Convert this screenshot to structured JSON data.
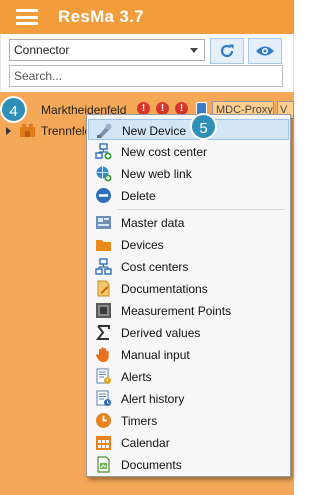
{
  "app": {
    "title": "ResMa 3.7"
  },
  "toolbar": {
    "selector_value": "Connector",
    "search_placeholder": "Search..."
  },
  "tree": {
    "rows": [
      {
        "label": "Marktheidenfeld",
        "alerts": [
          "!",
          "!",
          "!"
        ],
        "tag": "MDC-Proxy",
        "tag2": "V"
      },
      {
        "label": "Trennfeld"
      }
    ]
  },
  "annotations": {
    "step4": "4",
    "step5": "5"
  },
  "context_menu": {
    "items": [
      {
        "label": "New Device",
        "icon": "new-device-icon",
        "highlighted": true
      },
      {
        "label": "New cost center",
        "icon": "new-cost-center-icon"
      },
      {
        "label": "New web link",
        "icon": "new-web-link-icon"
      },
      {
        "label": "Delete",
        "icon": "delete-icon"
      },
      {
        "label": "Master data",
        "icon": "master-data-icon"
      },
      {
        "label": "Devices",
        "icon": "devices-folder-icon"
      },
      {
        "label": "Cost centers",
        "icon": "cost-centers-icon"
      },
      {
        "label": "Documentations",
        "icon": "documentations-icon"
      },
      {
        "label": "Measurement Points",
        "icon": "measurement-points-icon"
      },
      {
        "label": "Derived values",
        "icon": "sigma-icon"
      },
      {
        "label": "Manual input",
        "icon": "hand-icon"
      },
      {
        "label": "Alerts",
        "icon": "alerts-icon"
      },
      {
        "label": "Alert history",
        "icon": "alert-history-icon"
      },
      {
        "label": "Timers",
        "icon": "clock-icon"
      },
      {
        "label": "Calendar",
        "icon": "calendar-icon"
      },
      {
        "label": "Documents",
        "icon": "documents-icon"
      }
    ]
  },
  "colors": {
    "titlebar": "#f39c3c",
    "tree_background": "#f5a857",
    "badge": "#2e8fb7",
    "menu_highlight": "#d3e6f8",
    "alert": "#d9362b"
  }
}
